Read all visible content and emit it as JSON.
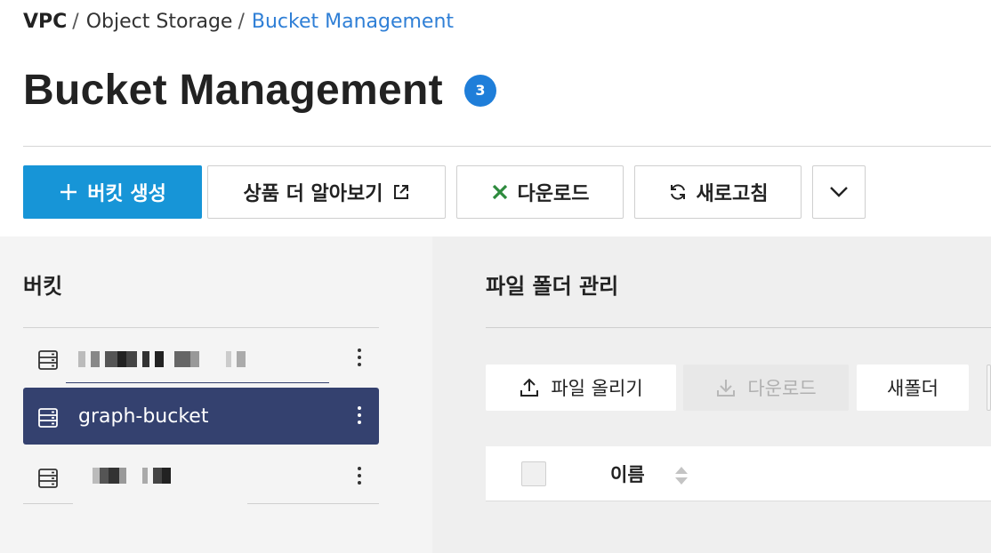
{
  "breadcrumb": {
    "root": "VPC",
    "separator": "/",
    "mid": "Object Storage",
    "current": "Bucket Management"
  },
  "header": {
    "title": "Bucket Management",
    "count": "3"
  },
  "toolbar": {
    "create_label": "버킷 생성",
    "learn_more_label": "상품 더 알아보기",
    "download_label": "다운로드",
    "refresh_label": "새로고침"
  },
  "left_panel": {
    "title": "버킷",
    "buckets": [
      {
        "name": "",
        "obscured": true,
        "selected": false
      },
      {
        "name": "graph-bucket",
        "obscured": false,
        "selected": true
      },
      {
        "name": "",
        "obscured": true,
        "selected": false
      }
    ]
  },
  "right_panel": {
    "title": "파일 폴더 관리",
    "upload_label": "파일 올리기",
    "download_label": "다운로드",
    "new_folder_label": "새폴더",
    "table": {
      "columns": [
        "이름"
      ]
    }
  },
  "colors": {
    "primary": "#1795d7",
    "accent_link": "#2f7fd6",
    "badge": "#1f7ed9",
    "selected_row": "#34416f",
    "excel_green": "#2e8b3e"
  }
}
